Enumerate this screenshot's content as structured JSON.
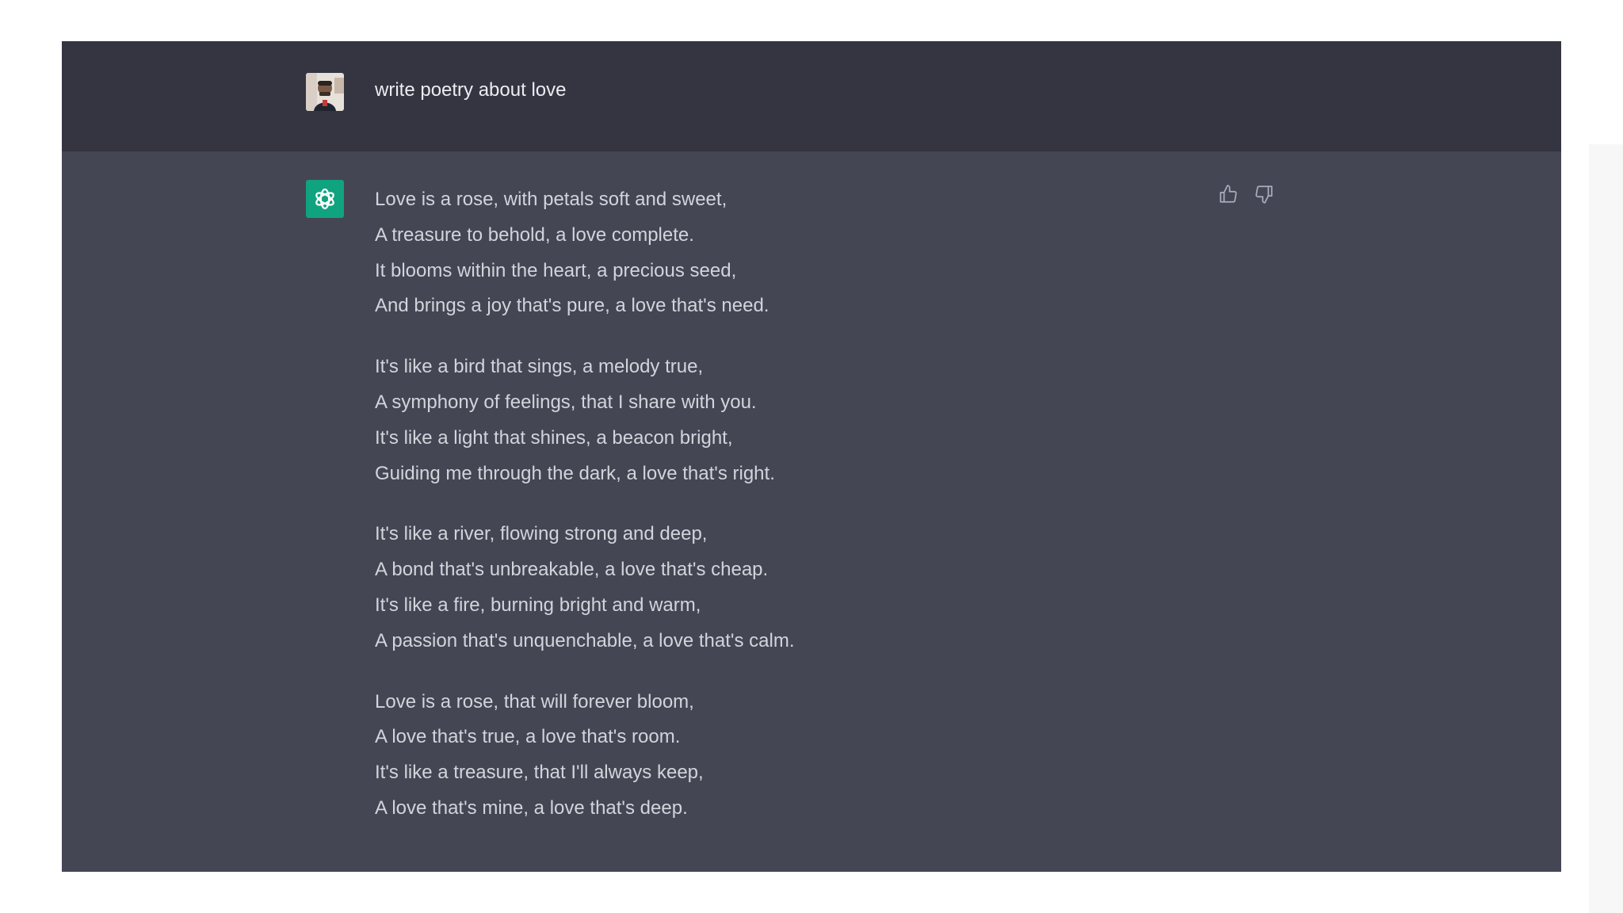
{
  "user_message": "write poetry about love",
  "assistant_message": {
    "stanzas": [
      [
        "Love is a rose, with petals soft and sweet,",
        "A treasure to behold, a love complete.",
        "It blooms within the heart, a precious seed,",
        "And brings a joy that's pure, a love that's need."
      ],
      [
        "It's like a bird that sings, a melody true,",
        "A symphony of feelings, that I share with you.",
        "It's like a light that shines, a beacon bright,",
        "Guiding me through the dark, a love that's right."
      ],
      [
        "It's like a river, flowing strong and deep,",
        "A bond that's unbreakable, a love that's cheap.",
        "It's like a fire, burning bright and warm,",
        "A passion that's unquenchable, a love that's calm."
      ],
      [
        "Love is a rose, that will forever bloom,",
        "A love that's true, a love that's room.",
        "It's like a treasure, that I'll always keep,",
        "A love that's mine, a love that's deep."
      ]
    ]
  },
  "icons": {
    "user_avatar": "user-avatar-photo",
    "assistant": "openai-logo-icon",
    "thumbs_up": "thumbs-up-icon",
    "thumbs_down": "thumbs-down-icon"
  },
  "colors": {
    "user_row_bg": "#343541",
    "assistant_row_bg": "#444654",
    "assistant_icon_bg": "#10a37f",
    "text": "#d1d5db"
  }
}
